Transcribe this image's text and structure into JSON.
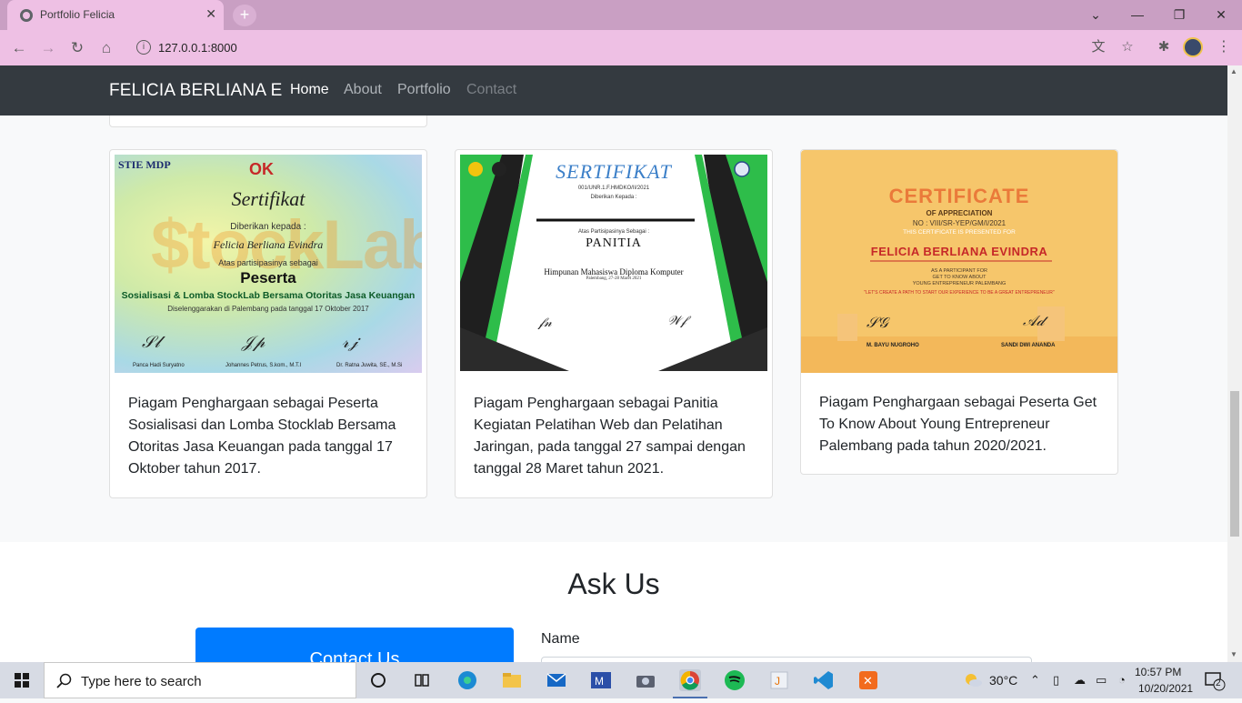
{
  "browser": {
    "tab_title": "Portfolio Felicia",
    "tab_close": "✕",
    "new_tab": "+",
    "url": "127.0.0.1:8000",
    "window": {
      "minimize": "—",
      "restore": "❐",
      "close": "✕",
      "chevron": "⌄"
    }
  },
  "navbar": {
    "brand": "FELICIA BERLIANA E",
    "links": [
      {
        "label": "Home",
        "color": "#ffffff"
      },
      {
        "label": "About",
        "color": "#aeb3b8"
      },
      {
        "label": "Portfolio",
        "color": "#aeb3b8"
      },
      {
        "label": "Contact",
        "color": "#7b8086"
      }
    ]
  },
  "certificates": [
    {
      "image": {
        "logo_left": "STIE MDP",
        "logo_ok": "OK",
        "title": "Sertifikat",
        "given_to": "Diberikan kepada :",
        "name": "Felicia Berliana Evindra",
        "as": "Atas partisipasinya sebagai",
        "role": "Peserta",
        "event": "Sosialisasi & Lomba StockLab Bersama Otoritas Jasa Keuangan",
        "detail": "Diselenggarakan di Palembang pada tanggal 17 Oktober 2017",
        "signers": [
          "Panca Hadi Suryatno",
          "Johannes Petrus, S.kom., M.T.I",
          "Dr. Ratna Juwita, SE., M.Si"
        ]
      },
      "description": "Piagam Penghargaan sebagai Peserta Sosialisasi dan Lomba Stocklab Bersama Otoritas Jasa Keuangan pada tanggal 17 Oktober tahun 2017."
    },
    {
      "image": {
        "title": "SERTIFIKAT",
        "number": "001/UNR.1.F.HMDKO/II/2021",
        "given_to": "Diberikan Kepada :",
        "as": "Atas Partisipasinya Sebagai :",
        "role": "PANITIA",
        "org": "Himpunan Mahasiswa Diploma Komputer",
        "date": "Palembang, 27-28 Maret 2021"
      },
      "description": "Piagam Penghargaan sebagai Panitia Kegiatan Pelatihan Web dan Pelatihan Jaringan, pada tanggal 27 sampai dengan tanggal 28 Maret tahun 2021."
    },
    {
      "image": {
        "title": "CERTIFICATE",
        "subtitle": "OF APPRECIATION",
        "number": "NO : VIII/SR-YEP/GM/I/2021",
        "presented": "THIS CERTIFICATE IS PRESENTED FOR",
        "name": "FELICIA BERLIANA EVINDRA",
        "as": "AS A PARTICIPANT FOR",
        "event1": "GET TO KNOW ABOUT",
        "event2": "YOUNG ENTREPRENEUR PALEMBANG",
        "tagline": "\"LET'S CREATE A PATH TO START OUR EXPERIENCE TO BE A GREAT ENTREPRENEUR\"",
        "signers": [
          "M. BAYU NUGROHO",
          "SANDI DWI ANANDA"
        ]
      },
      "description": "Piagam Penghargaan sebagai Peserta Get To Know About Young Entrepreneur Palembang pada tahun 2020/2021."
    }
  ],
  "ask": {
    "title": "Ask Us",
    "contact_button": "Contact Us",
    "name_label": "Name"
  },
  "taskbar": {
    "search_placeholder": "Type here to search",
    "weather": "30°C",
    "time": "10:57 PM",
    "date": "10/20/2021",
    "notifications": "2"
  }
}
